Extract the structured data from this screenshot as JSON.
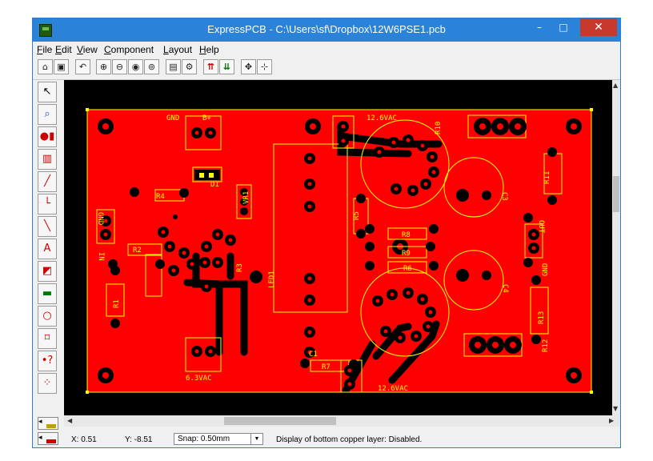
{
  "window": {
    "title": "ExpressPCB - C:\\Users\\sf\\Dropbox\\12W6PSE1.pcb",
    "min_label": "–",
    "max_label": "□",
    "close_label": "✕"
  },
  "menu": [
    "File",
    "Edit",
    "View",
    "Component",
    "Layout",
    "Help"
  ],
  "toolbar_icons": [
    "open-file-icon",
    "save-icon",
    "undo-icon",
    "zoom-in-icon",
    "zoom-out-icon",
    "zoom-area-icon",
    "zoom-fit-icon",
    "properties-icon",
    "component-manager-icon",
    "top-layer-icon",
    "bottom-layer-icon",
    "move-icon",
    "center-icon"
  ],
  "left_tools": [
    "select-tool-icon",
    "zoom-tool-icon",
    "pad-tool-icon",
    "component-tool-icon",
    "trace-tool-icon",
    "corner-trace-icon",
    "diagonal-trace-icon",
    "text-tool-icon",
    "fill-plane-icon",
    "ground-plane-icon",
    "circle-tool-icon",
    "rectangle-tool-icon",
    "query-tool-icon",
    "ratsnest-tool-icon"
  ],
  "pcb_labels": {
    "gnd_top": "GND",
    "b_plus": "B+",
    "ac_12_6_top": "12.6VAC",
    "r10": "R10",
    "r4": "R4",
    "d1": "D1",
    "vr1": "VR1",
    "r11": "R11",
    "gnd_left": "GND",
    "r5": "R5",
    "c3": "C3",
    "in": "IN",
    "r2": "R2",
    "r8": "R8",
    "r9": "R9",
    "r6": "R6",
    "r3": "R3",
    "led1": "LED1",
    "out": "OUT",
    "gnd_right": "GND",
    "r1": "R1",
    "c4": "C4",
    "r13": "R13",
    "r12": "R12",
    "c1": "C1",
    "r7": "R7",
    "ac_6_3": "6.3VAC",
    "ac_12_6_bottom": "12.6VAC"
  },
  "status": {
    "x": "X: 0.51",
    "y": "Y: -8.51",
    "snap": "Snap:  0.50mm",
    "message": "Display of bottom copper layer:  Disabled."
  },
  "colors": {
    "copper": "#ff0000",
    "silkscreen": "#ffff00",
    "board_bg": "#000000",
    "titlebar": "#2b82d9"
  }
}
